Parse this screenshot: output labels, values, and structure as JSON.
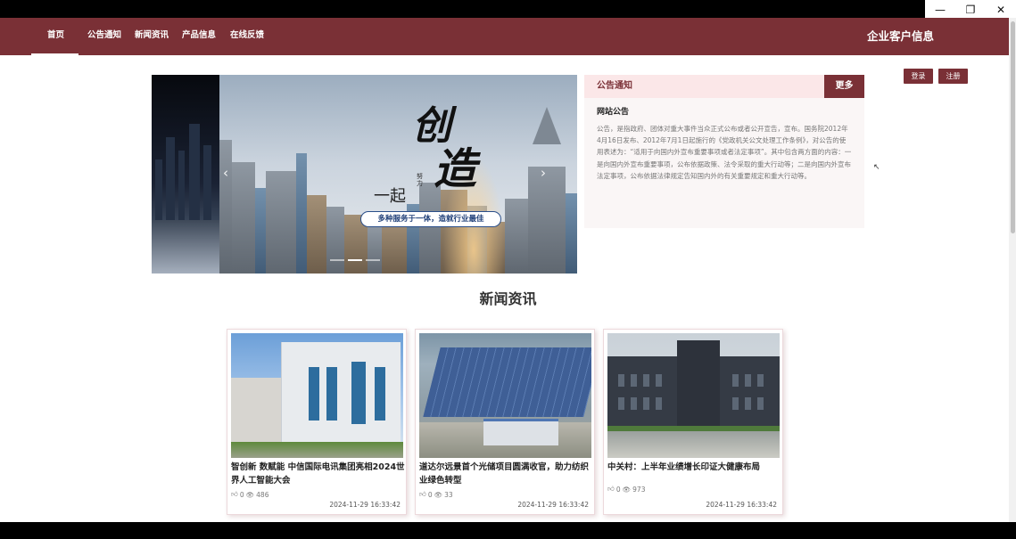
{
  "window": {
    "controls": [
      "—",
      "❐",
      "✕"
    ]
  },
  "nav": {
    "items": [
      "首页",
      "公告通知",
      "新闻资讯",
      "产品信息",
      "在线反馈"
    ],
    "brand": "企业客户信息"
  },
  "auth": {
    "login": "登录",
    "register": "注册"
  },
  "banner": {
    "calligraphy_a": "一起",
    "calligraphy_b": "创",
    "calligraphy_c": "造",
    "calligraphy_d": "努力",
    "slogan": "多种服务于一体，造就行业最佳",
    "prev": "‹",
    "next": "›"
  },
  "notice": {
    "title": "公告通知",
    "more": "更多",
    "subtitle": "网站公告",
    "body": "公告，是指政府、团体对重大事件当众正式公布或者公开宣告，宣布。国务院2012年4月16日发布、2012年7月1日起施行的《党政机关公文处理工作条例》，对公告的使用表述为：“适用于向国内外宣布重要事项或者法定事项”。其中包含两方面的内容：一是向国内外宣布重要事项，公布依据政策、法令采取的重大行动等；二是向国内外宣布法定事项，公布依据法律规定告知国内外的有关重要规定和重大行动等。"
  },
  "news": {
    "section_title": "新闻资讯",
    "items": [
      {
        "title": "智创新 数赋能 中信国际电讯集团亮相2024世界人工智能大会",
        "likes": "0",
        "views": "486",
        "date": "2024-11-29 16:33:42"
      },
      {
        "title": "道达尔远景首个光储项目圆满收官，助力纺织业绿色转型",
        "likes": "0",
        "views": "33",
        "date": "2024-11-29 16:33:42"
      },
      {
        "title": "中关村：上半年业绩增长印证大健康布局",
        "likes": "0",
        "views": "973",
        "date": "2024-11-29 16:33:42"
      }
    ]
  },
  "colors": {
    "brand": "#7a3036",
    "notice_head_bg": "#fbe7e8"
  }
}
